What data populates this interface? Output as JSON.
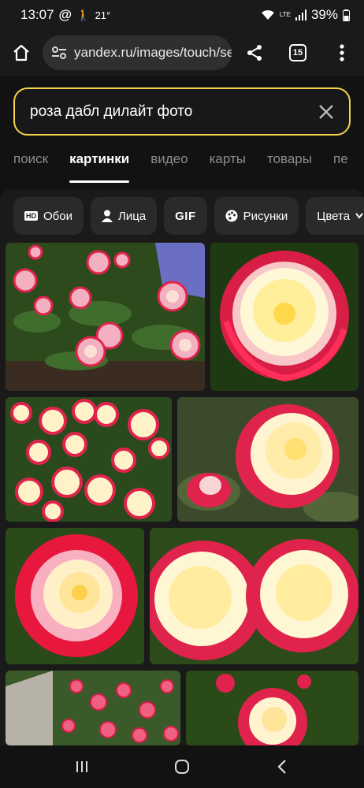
{
  "status": {
    "time": "13:07",
    "temp": "21",
    "temp_unit": "°",
    "network": "LTE",
    "battery": "39%"
  },
  "browser": {
    "url": "yandex.ru/images/touch/se",
    "tab_count": "15"
  },
  "search": {
    "query": "роза дабл дилайт фото"
  },
  "tabs": [
    {
      "label": "поиск"
    },
    {
      "label": "картинки"
    },
    {
      "label": "видео"
    },
    {
      "label": "карты"
    },
    {
      "label": "товары"
    },
    {
      "label": "пе"
    }
  ],
  "filters": [
    {
      "label": "Обои",
      "icon": "hd-icon"
    },
    {
      "label": "Лица",
      "icon": "person-icon"
    },
    {
      "label": "GIF",
      "icon": ""
    },
    {
      "label": "Рисунки",
      "icon": "palette-icon"
    },
    {
      "label": "Цвета",
      "icon": "chevron-down-icon"
    }
  ],
  "colors": {
    "search_border": "#f5d44a",
    "rose_pink": "#e0234c",
    "rose_cream": "#fff3b8",
    "leaf_green": "#2f5a22"
  }
}
